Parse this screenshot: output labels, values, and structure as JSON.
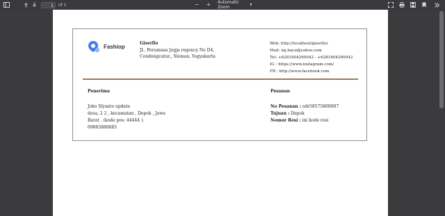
{
  "toolbar": {
    "page_current": "1",
    "page_total": "of 1",
    "zoom_label": "Automatic Zoom",
    "zoom_minus": "−",
    "zoom_plus": "+"
  },
  "invoice": {
    "brand": "Fashiop",
    "company": {
      "name": "Giserllo",
      "address_line1": "JL. Perumnas Jogja regency No D4,",
      "address_line2": "Condongcatur,, Sleman, Yogyakarta"
    },
    "contact": {
      "web": "Web: http://localhost/giserllo/",
      "mail": "Mail: ng.bayu@yahoo.com",
      "tel": "Tel: +6281804260042 - +6281804260042",
      "ig": "IG : https://www.instagram.com/",
      "fb": "FB : http://www.facebook.com"
    },
    "receiver": {
      "title": "Penerima",
      "name": "Joko Slyanto update",
      "line1": "desa, 2 2 , kecamatan , Depok , Jawa",
      "line2": "Barat . (kode pos: 44444 ).",
      "phone": "09883888883"
    },
    "order": {
      "title": "Pesanan",
      "no_label": "No Pesanan :",
      "no_value": " odr58575800007",
      "dest_label": "Tujuan :",
      "dest_value": " Depok",
      "resi_label": "Nomor Resi :",
      "resi_value": " ini kode resi"
    }
  },
  "colors": {
    "divider": "#9b7a4a",
    "logo_blue": "#3f7ee8"
  }
}
